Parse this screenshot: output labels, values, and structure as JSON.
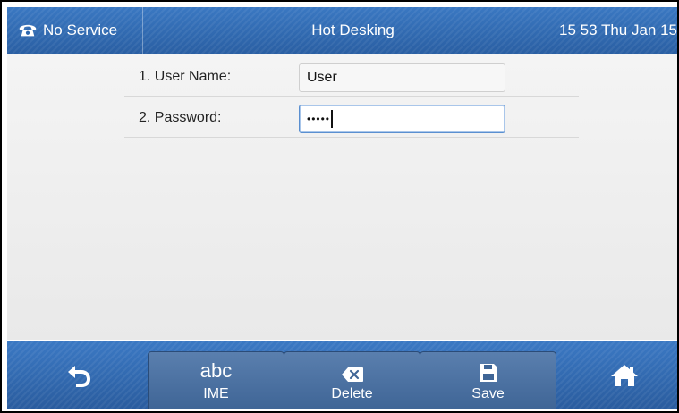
{
  "titlebar": {
    "status_text": "No Service",
    "title": "Hot Desking",
    "datetime": "15 53 Thu Jan 15"
  },
  "form": {
    "fields": [
      {
        "label": "1. User Name:",
        "value": "User"
      },
      {
        "label": "2. Password:",
        "value": "•••••",
        "masked": true,
        "focused": true
      }
    ]
  },
  "softkeys": {
    "back_icon": "back-arrow-icon",
    "ime_top": "abc",
    "ime_label": "IME",
    "delete_label": "Delete",
    "save_label": "Save",
    "home_icon": "home-icon"
  },
  "colors": {
    "bar_blue": "#2d67ae",
    "softkey_blue": "#4a6f9f",
    "content_bg": "#f0f0f0"
  }
}
